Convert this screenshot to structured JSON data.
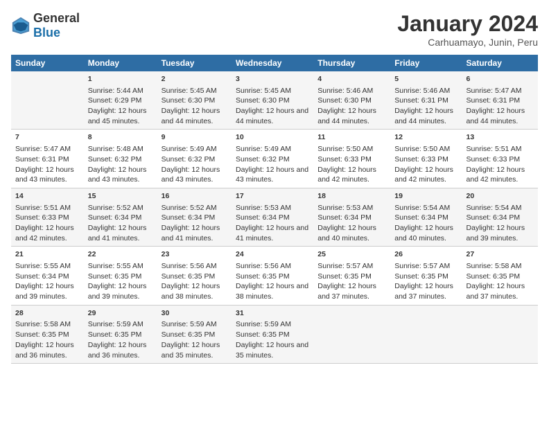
{
  "logo": {
    "general": "General",
    "blue": "Blue"
  },
  "title": "January 2024",
  "subtitle": "Carhuamayo, Junin, Peru",
  "header_days": [
    "Sunday",
    "Monday",
    "Tuesday",
    "Wednesday",
    "Thursday",
    "Friday",
    "Saturday"
  ],
  "weeks": [
    [
      {
        "day": "",
        "sunrise": "",
        "sunset": "",
        "daylight": ""
      },
      {
        "day": "1",
        "sunrise": "Sunrise: 5:44 AM",
        "sunset": "Sunset: 6:29 PM",
        "daylight": "Daylight: 12 hours and 45 minutes."
      },
      {
        "day": "2",
        "sunrise": "Sunrise: 5:45 AM",
        "sunset": "Sunset: 6:30 PM",
        "daylight": "Daylight: 12 hours and 44 minutes."
      },
      {
        "day": "3",
        "sunrise": "Sunrise: 5:45 AM",
        "sunset": "Sunset: 6:30 PM",
        "daylight": "Daylight: 12 hours and 44 minutes."
      },
      {
        "day": "4",
        "sunrise": "Sunrise: 5:46 AM",
        "sunset": "Sunset: 6:30 PM",
        "daylight": "Daylight: 12 hours and 44 minutes."
      },
      {
        "day": "5",
        "sunrise": "Sunrise: 5:46 AM",
        "sunset": "Sunset: 6:31 PM",
        "daylight": "Daylight: 12 hours and 44 minutes."
      },
      {
        "day": "6",
        "sunrise": "Sunrise: 5:47 AM",
        "sunset": "Sunset: 6:31 PM",
        "daylight": "Daylight: 12 hours and 44 minutes."
      }
    ],
    [
      {
        "day": "7",
        "sunrise": "Sunrise: 5:47 AM",
        "sunset": "Sunset: 6:31 PM",
        "daylight": "Daylight: 12 hours and 43 minutes."
      },
      {
        "day": "8",
        "sunrise": "Sunrise: 5:48 AM",
        "sunset": "Sunset: 6:32 PM",
        "daylight": "Daylight: 12 hours and 43 minutes."
      },
      {
        "day": "9",
        "sunrise": "Sunrise: 5:49 AM",
        "sunset": "Sunset: 6:32 PM",
        "daylight": "Daylight: 12 hours and 43 minutes."
      },
      {
        "day": "10",
        "sunrise": "Sunrise: 5:49 AM",
        "sunset": "Sunset: 6:32 PM",
        "daylight": "Daylight: 12 hours and 43 minutes."
      },
      {
        "day": "11",
        "sunrise": "Sunrise: 5:50 AM",
        "sunset": "Sunset: 6:33 PM",
        "daylight": "Daylight: 12 hours and 42 minutes."
      },
      {
        "day": "12",
        "sunrise": "Sunrise: 5:50 AM",
        "sunset": "Sunset: 6:33 PM",
        "daylight": "Daylight: 12 hours and 42 minutes."
      },
      {
        "day": "13",
        "sunrise": "Sunrise: 5:51 AM",
        "sunset": "Sunset: 6:33 PM",
        "daylight": "Daylight: 12 hours and 42 minutes."
      }
    ],
    [
      {
        "day": "14",
        "sunrise": "Sunrise: 5:51 AM",
        "sunset": "Sunset: 6:33 PM",
        "daylight": "Daylight: 12 hours and 42 minutes."
      },
      {
        "day": "15",
        "sunrise": "Sunrise: 5:52 AM",
        "sunset": "Sunset: 6:34 PM",
        "daylight": "Daylight: 12 hours and 41 minutes."
      },
      {
        "day": "16",
        "sunrise": "Sunrise: 5:52 AM",
        "sunset": "Sunset: 6:34 PM",
        "daylight": "Daylight: 12 hours and 41 minutes."
      },
      {
        "day": "17",
        "sunrise": "Sunrise: 5:53 AM",
        "sunset": "Sunset: 6:34 PM",
        "daylight": "Daylight: 12 hours and 41 minutes."
      },
      {
        "day": "18",
        "sunrise": "Sunrise: 5:53 AM",
        "sunset": "Sunset: 6:34 PM",
        "daylight": "Daylight: 12 hours and 40 minutes."
      },
      {
        "day": "19",
        "sunrise": "Sunrise: 5:54 AM",
        "sunset": "Sunset: 6:34 PM",
        "daylight": "Daylight: 12 hours and 40 minutes."
      },
      {
        "day": "20",
        "sunrise": "Sunrise: 5:54 AM",
        "sunset": "Sunset: 6:34 PM",
        "daylight": "Daylight: 12 hours and 39 minutes."
      }
    ],
    [
      {
        "day": "21",
        "sunrise": "Sunrise: 5:55 AM",
        "sunset": "Sunset: 6:34 PM",
        "daylight": "Daylight: 12 hours and 39 minutes."
      },
      {
        "day": "22",
        "sunrise": "Sunrise: 5:55 AM",
        "sunset": "Sunset: 6:35 PM",
        "daylight": "Daylight: 12 hours and 39 minutes."
      },
      {
        "day": "23",
        "sunrise": "Sunrise: 5:56 AM",
        "sunset": "Sunset: 6:35 PM",
        "daylight": "Daylight: 12 hours and 38 minutes."
      },
      {
        "day": "24",
        "sunrise": "Sunrise: 5:56 AM",
        "sunset": "Sunset: 6:35 PM",
        "daylight": "Daylight: 12 hours and 38 minutes."
      },
      {
        "day": "25",
        "sunrise": "Sunrise: 5:57 AM",
        "sunset": "Sunset: 6:35 PM",
        "daylight": "Daylight: 12 hours and 37 minutes."
      },
      {
        "day": "26",
        "sunrise": "Sunrise: 5:57 AM",
        "sunset": "Sunset: 6:35 PM",
        "daylight": "Daylight: 12 hours and 37 minutes."
      },
      {
        "day": "27",
        "sunrise": "Sunrise: 5:58 AM",
        "sunset": "Sunset: 6:35 PM",
        "daylight": "Daylight: 12 hours and 37 minutes."
      }
    ],
    [
      {
        "day": "28",
        "sunrise": "Sunrise: 5:58 AM",
        "sunset": "Sunset: 6:35 PM",
        "daylight": "Daylight: 12 hours and 36 minutes."
      },
      {
        "day": "29",
        "sunrise": "Sunrise: 5:59 AM",
        "sunset": "Sunset: 6:35 PM",
        "daylight": "Daylight: 12 hours and 36 minutes."
      },
      {
        "day": "30",
        "sunrise": "Sunrise: 5:59 AM",
        "sunset": "Sunset: 6:35 PM",
        "daylight": "Daylight: 12 hours and 35 minutes."
      },
      {
        "day": "31",
        "sunrise": "Sunrise: 5:59 AM",
        "sunset": "Sunset: 6:35 PM",
        "daylight": "Daylight: 12 hours and 35 minutes."
      },
      {
        "day": "",
        "sunrise": "",
        "sunset": "",
        "daylight": ""
      },
      {
        "day": "",
        "sunrise": "",
        "sunset": "",
        "daylight": ""
      },
      {
        "day": "",
        "sunrise": "",
        "sunset": "",
        "daylight": ""
      }
    ]
  ]
}
